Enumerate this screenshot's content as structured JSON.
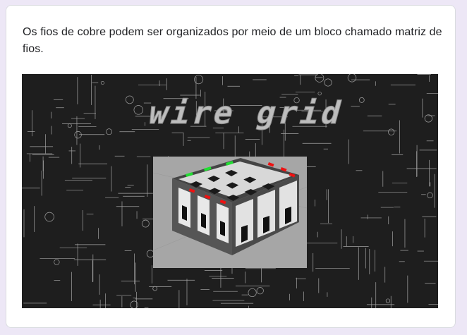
{
  "question": {
    "text": "Os fios de cobre podem ser organizados por meio de um bloco chamado matriz de fios."
  },
  "image": {
    "logo_text": "wire grid",
    "background_color": "#1e1e1e",
    "panel_color": "#a6a6a6",
    "accent_green": "#22dd33",
    "accent_red": "#ee1111"
  }
}
